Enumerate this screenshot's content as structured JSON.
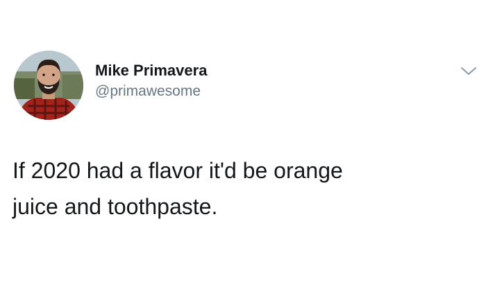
{
  "tweet": {
    "author": {
      "display_name": "Mike Primavera",
      "handle": "@primawesome",
      "avatar_icon": "profile-photo"
    },
    "menu_icon": "chevron-down-icon",
    "text_line_1": "If 2020 had a flavor it'd be orange",
    "text_line_2": "juice and toothpaste."
  },
  "colors": {
    "background": "#ffffff",
    "text": "#14171a",
    "secondary_text": "#657786"
  }
}
